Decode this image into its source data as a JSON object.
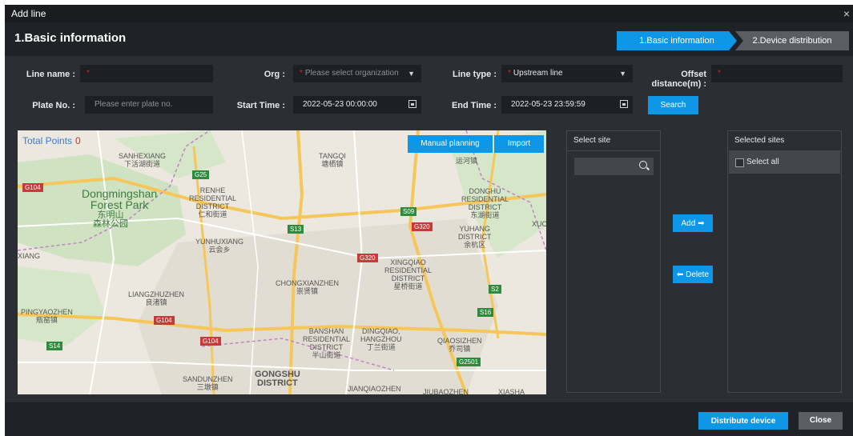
{
  "dialog": {
    "title": "Add line",
    "close_icon": "×"
  },
  "header": {
    "title": "1.Basic information",
    "steps": [
      "1.Basic information",
      "2.Device distribution"
    ]
  },
  "form": {
    "line_name_label": "Line name :",
    "org_label": "Org :",
    "org_placeholder": "Please select organization",
    "line_type_label": "Line type :",
    "line_type_value": "Upstream line",
    "offset_label": "Offset distance(m) :",
    "plate_label": "Plate No. :",
    "plate_placeholder": "Please enter plate no.",
    "start_label": "Start Time :",
    "start_value": "2022-05-23 00:00:00",
    "end_label": "End Time :",
    "end_value": "2022-05-23 23:59:59",
    "search_button": "Search",
    "required_mark": "*"
  },
  "map": {
    "total_label": "Total Points",
    "total_value": "0",
    "manual_button": "Manual planning",
    "import_button": "Import",
    "labels": {
      "sanhexiang": "SANHEXIANG\n下活湖街道",
      "tangqi": "TANGQI\n塘栖镇",
      "yunhe": "运河镇",
      "dongmingshan": "Dongmingshan\nForest Park",
      "dongmingshan_cn": "东明山\n森林公园",
      "renhe": "RENHE\nRESIDENTIAL\nDISTRICT\n仁和街道",
      "donghu": "DONGHU\nRESIDENTIAL\nDISTRICT\n东湖街道",
      "yuhang": "YUHANG\nDISTRICT\n余杭区",
      "xuc": "XUC",
      "yunhuxiang": "YUNHUXIANG\n云会乡",
      "xiang": "XIANG",
      "xingqiao": "XINGQIAO\nRESIDENTIAL\nDISTRICT\n星桥街道",
      "chongxian": "CHONGXIANZHEN\n崇贤镇",
      "liangzhu": "LIANGZHUZHEN\n良渚镇",
      "pingyao": "PINGYAOZHEN\n瓶窑镇",
      "banshan": "BANSHAN\nRESIDENTIAL\nDISTRICT\n半山街道",
      "dingqiao": "DINGQIAO,\nHANGZHOU\n丁兰街道",
      "qiaosi": "QIAOSIZHEN\n乔司镇",
      "sandun": "SANDUNZHEN\n三墩镇",
      "gongshu": "GONGSHU\nDISTRICT",
      "jianqiao": "JIANQIAOZHEN",
      "jiubao": "JIUBAOZHEN",
      "xiasha": "XIASHA"
    },
    "shields": {
      "g104_a": "G104",
      "g104_b": "G104",
      "g104_c": "G104",
      "g25": "G25",
      "s09": "S09",
      "g320_a": "G320",
      "g320_b": "G320",
      "s13": "S13",
      "s2": "S2",
      "s16": "S16",
      "s14": "S14",
      "g2501": "G2501"
    }
  },
  "select_site": {
    "title": "Select site"
  },
  "transfer": {
    "add_button": "Add ➡",
    "delete_button": "⬅ Delete"
  },
  "selected_sites": {
    "title": "Selected sites",
    "select_all": "Select all"
  },
  "footer": {
    "distribute_button": "Distribute device",
    "close_button": "Close"
  }
}
